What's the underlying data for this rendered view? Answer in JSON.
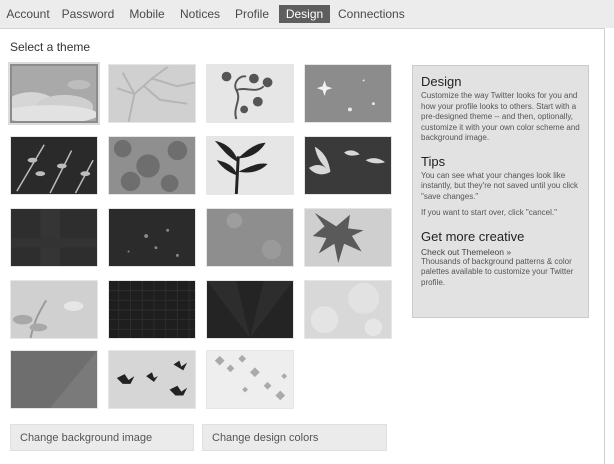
{
  "tabs": [
    {
      "label": "Account"
    },
    {
      "label": "Password"
    },
    {
      "label": "Mobile"
    },
    {
      "label": "Notices"
    },
    {
      "label": "Profile"
    },
    {
      "label": "Design",
      "active": true
    },
    {
      "label": "Connections"
    }
  ],
  "select_theme_label": "Select a theme",
  "themes": [
    {
      "name": "clouds",
      "selected": true
    },
    {
      "name": "tree-branches"
    },
    {
      "name": "curly-vines"
    },
    {
      "name": "sparkles"
    },
    {
      "name": "leafy-twigs"
    },
    {
      "name": "foliage-texture"
    },
    {
      "name": "plant-silhouette"
    },
    {
      "name": "flying-birds-dark"
    },
    {
      "name": "dark-speckle"
    },
    {
      "name": "night-lights"
    },
    {
      "name": "soft-flowers"
    },
    {
      "name": "maple-leaf"
    },
    {
      "name": "leaf-and-cloud"
    },
    {
      "name": "hex-pattern"
    },
    {
      "name": "dark-rays"
    },
    {
      "name": "bokeh"
    },
    {
      "name": "diagonal-split"
    },
    {
      "name": "birds"
    },
    {
      "name": "falling-leaves"
    }
  ],
  "sidebar": {
    "design_title": "Design",
    "design_text": "Customize the way Twitter looks for you and how your profile looks to others. Start with a pre-designed theme -- and then, optionally, customize it with your own color scheme and background image.",
    "tips_title": "Tips",
    "tips_text": "You can see what your changes look like instantly, but they're not saved until you click \"save changes.\"",
    "tips_text2": "If you want to start over, click \"cancel.\"",
    "creative_title": "Get more creative",
    "creative_link": "Check out Themeleon »",
    "creative_text": "Thousands of background patterns & color palettes available to customize your Twitter profile."
  },
  "buttons": {
    "change_background": "Change background image",
    "change_colors": "Change design colors"
  },
  "colors": {
    "tab_bar": "#ececec",
    "tab_active": "#5e5e5e",
    "panel_bg": "#e2e2e2"
  }
}
